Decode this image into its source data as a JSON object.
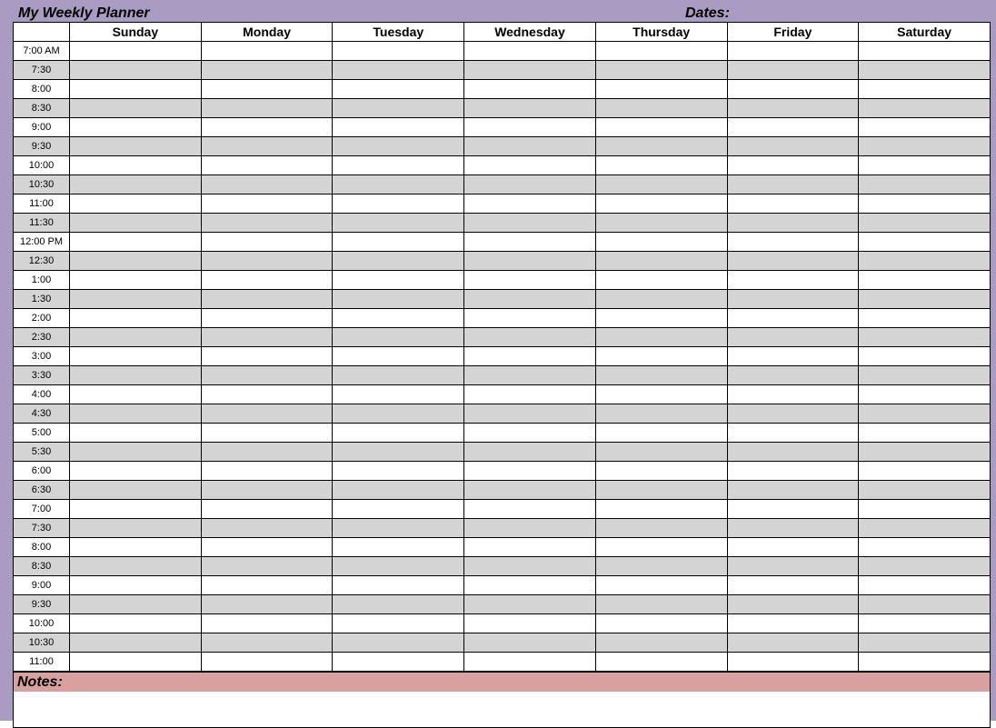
{
  "header": {
    "title": "My Weekly Planner",
    "dates_label": "Dates:"
  },
  "days": [
    "Sunday",
    "Monday",
    "Tuesday",
    "Wednesday",
    "Thursday",
    "Friday",
    "Saturday"
  ],
  "times": [
    "7:00 AM",
    "7:30",
    "8:00",
    "8:30",
    "9:00",
    "9:30",
    "10:00",
    "10:30",
    "11:00",
    "11:30",
    "12:00 PM",
    "12:30",
    "1:00",
    "1:30",
    "2:00",
    "2:30",
    "3:00",
    "3:30",
    "4:00",
    "4:30",
    "5:00",
    "5:30",
    "6:00",
    "6:30",
    "7:00",
    "7:30",
    "8:00",
    "8:30",
    "9:00",
    "9:30",
    "10:00",
    "10:30",
    "11:00"
  ],
  "notes": {
    "label": "Notes:"
  }
}
